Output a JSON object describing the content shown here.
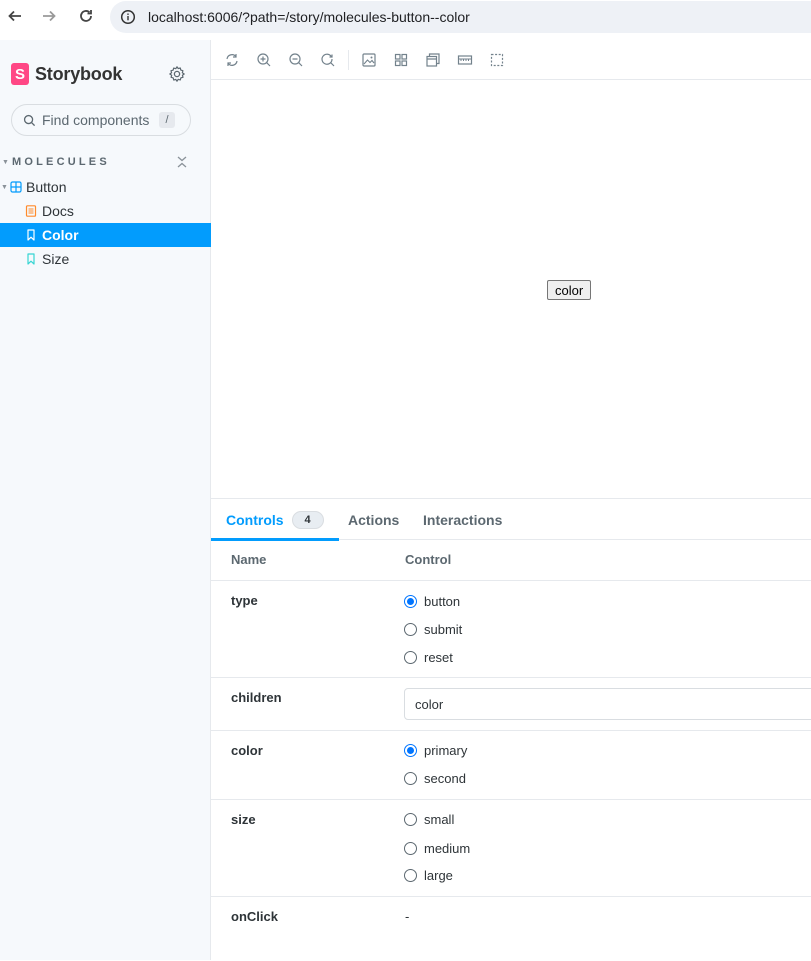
{
  "browser": {
    "url": "localhost:6006/?path=/story/molecules-button--color"
  },
  "sidebar": {
    "brand": "Storybook",
    "brand_logo_letter": "S",
    "search_placeholder": "Find components",
    "search_shortcut": "/",
    "group": "MOLECULES",
    "items": [
      {
        "label": "Button",
        "kind": "component"
      },
      {
        "label": "Docs",
        "kind": "docs"
      },
      {
        "label": "Color",
        "kind": "story",
        "selected": true
      },
      {
        "label": "Size",
        "kind": "story"
      }
    ]
  },
  "canvas": {
    "button_label": "color"
  },
  "panel": {
    "tabs": [
      {
        "label": "Controls",
        "badge": "4",
        "active": true
      },
      {
        "label": "Actions"
      },
      {
        "label": "Interactions"
      }
    ],
    "headers": {
      "name": "Name",
      "control": "Control"
    },
    "rows": {
      "type": {
        "name": "type",
        "options": [
          "button",
          "submit",
          "reset"
        ],
        "selected": "button"
      },
      "children": {
        "name": "children",
        "value": "color"
      },
      "color": {
        "name": "color",
        "options": [
          "primary",
          "second"
        ],
        "selected": "primary"
      },
      "size": {
        "name": "size",
        "options": [
          "small",
          "medium",
          "large"
        ],
        "selected": ""
      },
      "onClick": {
        "name": "onClick",
        "value": "-"
      }
    }
  },
  "colors": {
    "accent": "#029cfd",
    "brand": "#ff4785",
    "sidebar_bg": "#f6f9fc"
  }
}
